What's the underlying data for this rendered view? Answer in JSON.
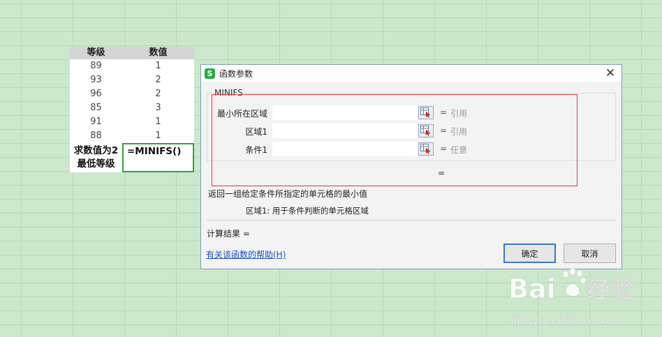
{
  "sheet": {
    "headers": [
      "等级",
      "数值"
    ],
    "rows": [
      [
        "89",
        "1"
      ],
      [
        "93",
        "2"
      ],
      [
        "96",
        "2"
      ],
      [
        "85",
        "3"
      ],
      [
        "91",
        "1"
      ],
      [
        "88",
        "1"
      ]
    ],
    "label_line1": "求数值为2",
    "label_line2": "最低等级",
    "formula": "=MINIFS()"
  },
  "dialog": {
    "title": "函数参数",
    "close": "✕",
    "function_name": "MINIFS",
    "params": [
      {
        "label": "最小所在区域",
        "value": "",
        "eq": "=",
        "hint": "引用"
      },
      {
        "label": "区域1",
        "value": "",
        "eq": "=",
        "hint": "引用"
      },
      {
        "label": "条件1",
        "value": "",
        "eq": "=",
        "hint": "任意"
      }
    ],
    "result_eq": "=",
    "description": "返回一组给定条件所指定的单元格的最小值",
    "param_description": "区域1:  用于条件判断的单元格区域",
    "calc_result": "计算结果 =",
    "help_link": "有关该函数的帮助(H)",
    "ok": "确定",
    "cancel": "取消"
  },
  "colors": {
    "sheet_bg": "#cce8cc",
    "accent_green": "#3e9b45",
    "highlight_red": "#d6393a",
    "link_blue": "#1a4fc4"
  },
  "watermark": {
    "brand": "Bai du 经验",
    "url": "jingyan.baidu.com"
  }
}
